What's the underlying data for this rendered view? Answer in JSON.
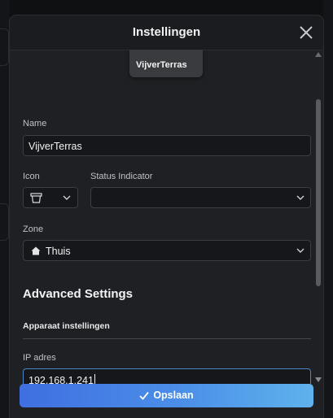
{
  "dialog": {
    "title": "Instellingen",
    "tooltip_text": "VijverTerras"
  },
  "form": {
    "name_label": "Name",
    "name_value": "VijverTerras",
    "icon_label": "Icon",
    "icon_selected": "planter-box-icon",
    "status_label": "Status Indicator",
    "status_value": "",
    "zone_label": "Zone",
    "zone_value": "Thuis",
    "zone_icon": "home-icon",
    "advanced_title": "Advanced Settings",
    "device_settings_title": "Apparaat instellingen",
    "ip_label": "IP adres",
    "ip_value": "192.168.1.241"
  },
  "footer": {
    "save_label": "Opslaan",
    "save_icon": "check-icon"
  },
  "colors": {
    "modal_bg": "#1f2023",
    "field_bg": "#16171a",
    "focus_border": "#4b86c6",
    "button_gradient_start": "#3f6fe0",
    "button_gradient_end": "#5fb2ec"
  }
}
